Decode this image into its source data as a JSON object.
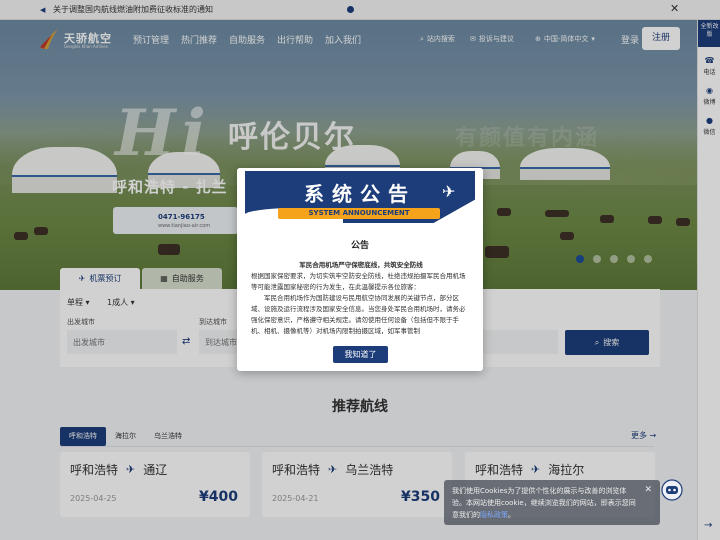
{
  "notice": {
    "text": "关于调整国内航线燃油附加费征收标准的通知",
    "close": "✕"
  },
  "nav": {
    "logo_cn": "天骄航空",
    "logo_en": "Genghis Khan Airlines",
    "links": [
      "预订管理",
      "热门推荐",
      "自助服务",
      "出行帮助",
      "加入我们"
    ],
    "tool_1": "站内搜索",
    "tool_2": "投诉与建议",
    "language": "中国-简体中文",
    "login": "登录",
    "register": "注册"
  },
  "hero": {
    "hi": "Hi",
    "city": "呼伦贝尔",
    "route": "呼和浩特 - 扎兰",
    "ad_phone": "0471-96175",
    "ad_site": "www.tianjiao-air.com",
    "ghost": "有颜值有内涵"
  },
  "sidebar": {
    "badge": "全新改版",
    "items": [
      "电话",
      "微博",
      "微信"
    ],
    "scroll_top": "→"
  },
  "search": {
    "tab_active": "机票预订",
    "tab_other": "自助服务",
    "trip_type": "单程",
    "passengers": "1成人",
    "from_label": "出发城市",
    "from_placeholder": "出发城市",
    "to_label": "到达城市",
    "to_placeholder": "到达城市",
    "button": "搜索"
  },
  "recommend": {
    "title": "推荐航线",
    "tabs": [
      "呼和浩特",
      "海拉尔",
      "乌兰浩特"
    ],
    "more": "更多",
    "cards": [
      {
        "from": "呼和浩特",
        "to": "通辽",
        "date": "2025-04-25",
        "price": "¥400"
      },
      {
        "from": "呼和浩特",
        "to": "乌兰浩特",
        "date": "2025-04-21",
        "price": "¥350"
      },
      {
        "from": "呼和浩特",
        "to": "海拉尔",
        "date": "",
        "price": ""
      }
    ]
  },
  "modal": {
    "title": "系统公告",
    "subtitle": "SYSTEM ANNOUNCEMENT",
    "heading": "公告",
    "body_title": "军民合用机场严守保密底线，共筑安全防线",
    "para1": "根据国家保密要求，为切实筑牢空防安全防线，杜绝违规拍摄军民合用机场等可能泄露国家秘密的行为发生，在此温馨提示各位旅客：",
    "para2": "军民合用机场作为国防建设与民用航空协同发展的关键节点，部分区域、设施及运行流程涉及国家安全信息。当您身处军民合用机场时，请务必强化保密意识，严格遵守相关规定。请勿使用任何设备（包括但不限于手机、相机、摄像机等）对机场内限制拍摄区域，如军事管制",
    "button": "我知道了"
  },
  "cookie": {
    "text": "我们使用Cookies为了提供个性化的展示与改善的浏览体验。本网站使用cookie，继续浏览我们的网站，即表示您同意我们的",
    "link": "隐私政策",
    "end": "。",
    "close": "✕"
  },
  "colors": {
    "brand": "#1d3d7a",
    "accent": "#f4a31b"
  }
}
